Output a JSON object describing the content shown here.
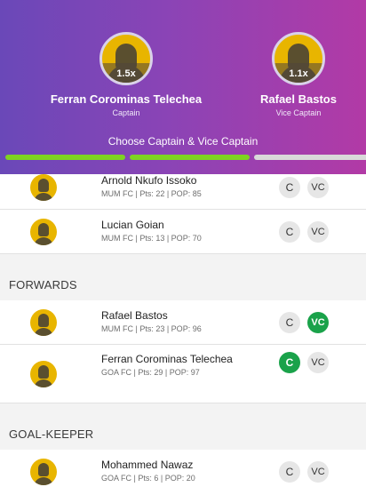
{
  "header": {
    "captain": {
      "name": "Ferran Corominas Telechea",
      "role": "Captain",
      "multiplier": "1.5x"
    },
    "vice_captain": {
      "name": "Rafael Bastos",
      "role": "Vice Captain",
      "multiplier": "1.1x"
    },
    "choose_text": "Choose Captain & Vice Captain",
    "progress_steps": [
      {
        "state": "done"
      },
      {
        "state": "done"
      },
      {
        "state": "pending"
      }
    ]
  },
  "colors": {
    "accent_green": "#1aa24a",
    "progress_green": "#7ed321",
    "gradient_start": "#6a48b8",
    "gradient_end": "#b23aa6",
    "avatar_yellow": "#e8b500"
  },
  "buttons": {
    "captain_label": "C",
    "vice_captain_label": "VC"
  },
  "players_top": [
    {
      "name": "Arnold Nkufo Issoko",
      "meta": "MUM FC | Pts: 22 | POP: 85",
      "captain": false,
      "vice_captain": false
    },
    {
      "name": "Lucian Goian",
      "meta": "MUM FC | Pts: 13 | POP: 70",
      "captain": false,
      "vice_captain": false
    }
  ],
  "sections": [
    {
      "title": "FORWARDS",
      "players": [
        {
          "name": "Rafael Bastos",
          "meta": "MUM FC | Pts: 23 | POP: 96",
          "captain": false,
          "vice_captain": true
        },
        {
          "name": "Ferran Corominas Telechea",
          "meta": "GOA FC | Pts: 29 | POP: 97",
          "captain": true,
          "vice_captain": false
        }
      ]
    },
    {
      "title": "GOAL-KEEPER",
      "players": [
        {
          "name": "Mohammed Nawaz",
          "meta": "GOA FC | Pts: 6 | POP: 20",
          "captain": false,
          "vice_captain": false
        }
      ]
    }
  ],
  "icons": {
    "avatar": "player-silhouette-icon"
  }
}
